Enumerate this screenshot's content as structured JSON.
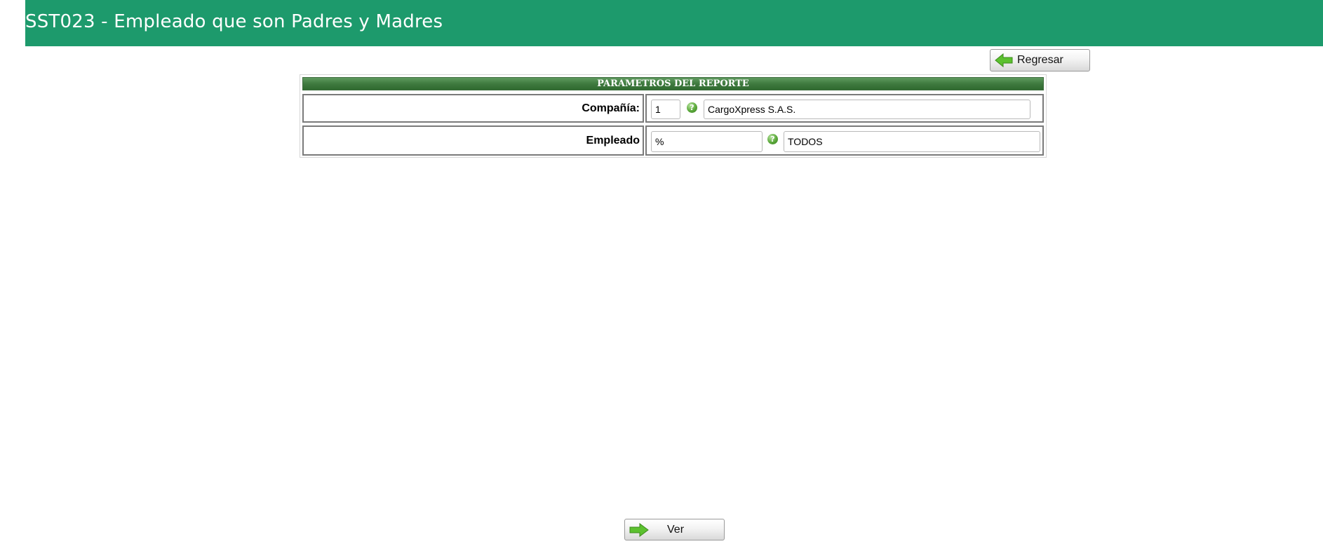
{
  "header": {
    "title": "SST023 - Empleado que son Padres y Madres"
  },
  "toolbar": {
    "back_label": "Regresar"
  },
  "params": {
    "title": "PARAMETROS DEL REPORTE",
    "company": {
      "label": "Compañía:",
      "code": "1",
      "name": "CargoXpress S.A.S."
    },
    "employee": {
      "label": "Empleado",
      "code": "%",
      "name": "TODOS"
    }
  },
  "footer": {
    "view_label": "Ver"
  },
  "colors": {
    "header_bg": "#1d9a6c",
    "table_header_bg": "#3f7a3f",
    "arrow": "#5cc12f"
  },
  "icons": [
    "back-arrow-icon",
    "help-icon",
    "forward-arrow-icon"
  ]
}
